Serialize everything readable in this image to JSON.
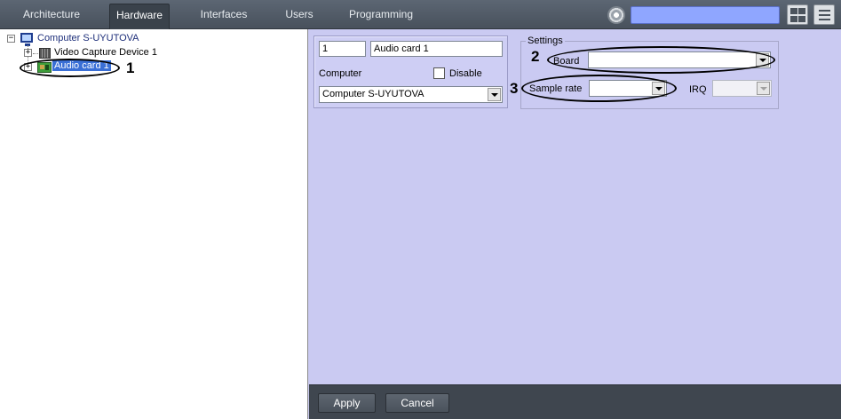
{
  "tabs": [
    {
      "label": "Architecture",
      "active": false
    },
    {
      "label": "Hardware",
      "active": true
    },
    {
      "label": "Interfaces",
      "active": false
    },
    {
      "label": "Users",
      "active": false
    },
    {
      "label": "Programming",
      "active": false
    }
  ],
  "toolbar": {
    "search_value": "",
    "icons": [
      "settings-gear-icon",
      "grid-view-icon",
      "menu-icon"
    ]
  },
  "tree": {
    "root": {
      "label": "Computer S-UYUTOVA",
      "expander": "⊟",
      "icon": "computer-icon"
    },
    "children": [
      {
        "label": "Video Capture Device 1",
        "expander": "+",
        "icon": "chip-icon"
      },
      {
        "label": "Audio card 1",
        "expander": "+",
        "icon": "audio-card-icon",
        "selected": true
      }
    ]
  },
  "callouts": [
    "1",
    "2",
    "3"
  ],
  "object": {
    "id": "1",
    "name": "Audio card 1",
    "computer_label": "Computer",
    "disable_label": "Disable",
    "disable_checked": false,
    "computer_value": "Computer S-UYUTOVA"
  },
  "settings": {
    "legend": "Settings",
    "board_label": "Board",
    "board_value": "",
    "sample_rate_label": "Sample rate",
    "sample_rate_value": "",
    "irq_label": "IRQ",
    "irq_value": ""
  },
  "buttons": {
    "apply": "Apply",
    "cancel": "Cancel"
  },
  "colors": {
    "topbar": "#4f5863",
    "panel_bg": "#cacaf2",
    "search_bg": "#8fa6ff",
    "selection": "#3a6fd6"
  }
}
